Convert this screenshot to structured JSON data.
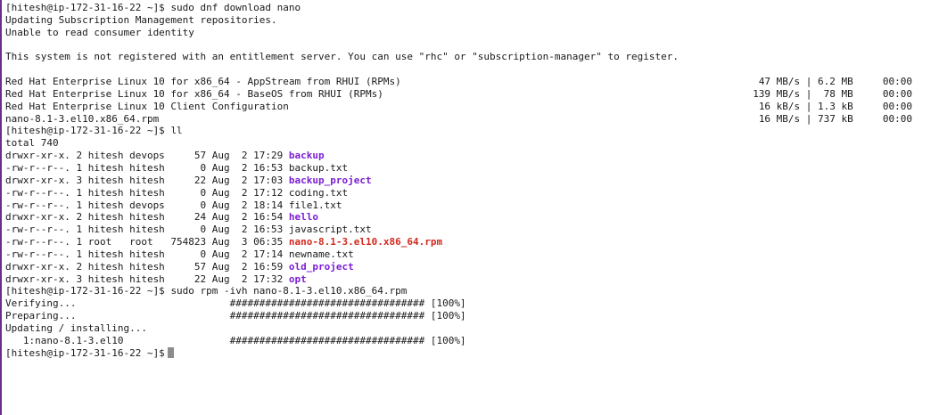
{
  "terminal": {
    "cmd1": {
      "prompt": "[hitesh@ip-172-31-16-22 ~]$",
      "command": "sudo dnf download nano"
    },
    "msg1": "Updating Subscription Management repositories.",
    "msg2": "Unable to read consumer identity",
    "msg3": "This system is not registered with an entitlement server. You can use \"rhc\" or \"subscription-manager\" to register.",
    "repos": [
      {
        "name": "Red Hat Enterprise Linux 10 for x86_64 - AppStream from RHUI (RPMs)",
        "stats": "47 MB/s | 6.2 MB     00:00"
      },
      {
        "name": "Red Hat Enterprise Linux 10 for x86_64 - BaseOS from RHUI (RPMs)",
        "stats": "139 MB/s |  78 MB     00:00"
      },
      {
        "name": "Red Hat Enterprise Linux 10 Client Configuration",
        "stats": "16 kB/s | 1.3 kB     00:00"
      },
      {
        "name": "nano-8.1-3.el10.x86_64.rpm",
        "stats": "16 MB/s | 737 kB     00:00"
      }
    ],
    "cmd2": {
      "prompt": "[hitesh@ip-172-31-16-22 ~]$",
      "command": "ll"
    },
    "total": "total 740",
    "listing": [
      {
        "meta": "drwxr-xr-x. 2 hitesh devops     57 Aug  2 17:29 ",
        "name": "backup",
        "type": "dir"
      },
      {
        "meta": "-rw-r--r--. 1 hitesh hitesh      0 Aug  2 16:53 ",
        "name": "backup.txt",
        "type": "file"
      },
      {
        "meta": "drwxr-xr-x. 3 hitesh hitesh     22 Aug  2 17:03 ",
        "name": "backup_project",
        "type": "dir"
      },
      {
        "meta": "-rw-r--r--. 1 hitesh hitesh      0 Aug  2 17:12 ",
        "name": "coding.txt",
        "type": "file"
      },
      {
        "meta": "-rw-r--r--. 1 hitesh devops      0 Aug  2 18:14 ",
        "name": "file1.txt",
        "type": "file"
      },
      {
        "meta": "drwxr-xr-x. 2 hitesh hitesh     24 Aug  2 16:54 ",
        "name": "hello",
        "type": "dir"
      },
      {
        "meta": "-rw-r--r--. 1 hitesh hitesh      0 Aug  2 16:53 ",
        "name": "javascript.txt",
        "type": "file"
      },
      {
        "meta": "-rw-r--r--. 1 root   root   754823 Aug  3 06:35 ",
        "name": "nano-8.1-3.el10.x86_64.rpm",
        "type": "rpm"
      },
      {
        "meta": "-rw-r--r--. 1 hitesh hitesh      0 Aug  2 17:14 ",
        "name": "newname.txt",
        "type": "file"
      },
      {
        "meta": "drwxr-xr-x. 2 hitesh hitesh     57 Aug  2 16:59 ",
        "name": "old_project",
        "type": "dir"
      },
      {
        "meta": "drwxr-xr-x. 3 hitesh hitesh     22 Aug  2 17:32 ",
        "name": "opt",
        "type": "dir"
      }
    ],
    "cmd3": {
      "prompt": "[hitesh@ip-172-31-16-22 ~]$",
      "command": "sudo rpm -ivh nano-8.1-3.el10.x86_64.rpm"
    },
    "rpm_output": [
      "Verifying...                          ################################# [100%]",
      "Preparing...                          ################################# [100%]",
      "Updating / installing...",
      "   1:nano-8.1-3.el10                  ################################# [100%]"
    ],
    "final_prompt": "[hitesh@ip-172-31-16-22 ~]$",
    "colors": {
      "directory": "#7a1fd4",
      "rpm_file": "#d12a1e",
      "border": "#6b2d8c"
    }
  }
}
